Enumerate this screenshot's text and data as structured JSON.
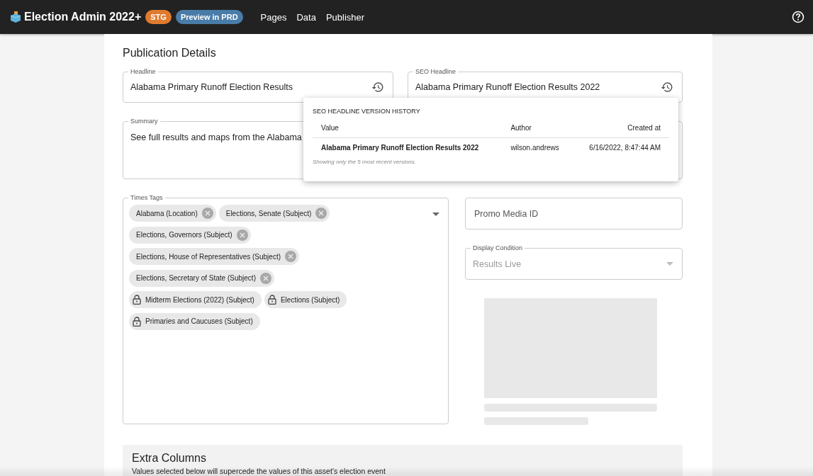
{
  "header": {
    "app_title": "Election Admin 2022+",
    "env_badge": "STG",
    "preview_badge": "Preview in PRD",
    "nav": [
      "Pages",
      "Data",
      "Publisher"
    ]
  },
  "section_title": "Publication Details",
  "headline": {
    "label": "Headline",
    "value": "Alabama Primary Runoff Election Results"
  },
  "seo_headline": {
    "label": "SEO Headline",
    "value": "Alabama Primary Runoff Election Results 2022"
  },
  "summary": {
    "label": "Summary",
    "value": "See full results and maps from the Alabama"
  },
  "version_history": {
    "title": "SEO HEADLINE VERSION HISTORY",
    "columns": [
      "Value",
      "Author",
      "Created at"
    ],
    "rows": [
      {
        "value": "Alabama Primary Runoff Election Results 2022",
        "author": "wilson.andrews",
        "created_at": "6/16/2022, 8:47:44 AM"
      }
    ],
    "note": "Showing only the 5 most recent versions."
  },
  "times_tags": {
    "label": "Times Tags",
    "tags": [
      {
        "label": "Alabama (Location)",
        "kind": "removable"
      },
      {
        "label": "Elections, Senate (Subject)",
        "kind": "removable"
      },
      {
        "label": "Elections, Governors (Subject)",
        "kind": "removable"
      },
      {
        "label": "Elections, House of Representatives (Subject)",
        "kind": "removable"
      },
      {
        "label": "Elections, Secretary of State (Subject)",
        "kind": "removable"
      },
      {
        "label": "Midterm Elections (2022) (Subject)",
        "kind": "locked"
      },
      {
        "label": "Elections (Subject)",
        "kind": "locked"
      },
      {
        "label": "Primaries and Caucuses (Subject)",
        "kind": "locked"
      }
    ]
  },
  "promo_media": {
    "placeholder": "Promo Media ID"
  },
  "display_condition": {
    "label": "Display Condition",
    "value": "Results Live",
    "disabled": true
  },
  "extra_columns": {
    "title": "Extra Columns",
    "description": "Values selected below will supercede the values of this asset's election event"
  }
}
